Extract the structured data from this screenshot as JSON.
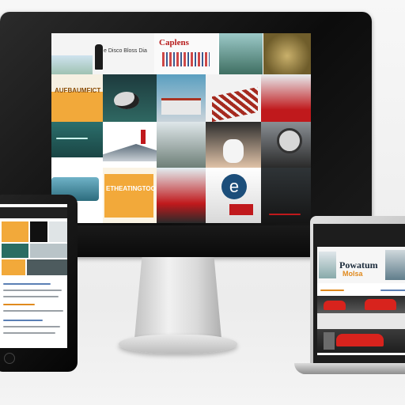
{
  "scene": {
    "background": "#f2f2f2",
    "devices": [
      "desktop-monitor",
      "tablet",
      "laptop"
    ]
  },
  "desktop": {
    "header_text": "e Disco Bloss Dia",
    "brand_text": "Caplens",
    "tiles": [
      {
        "caption": "AUFBAUMFICT",
        "color": "#f2a93a"
      },
      {
        "caption": "ETHEATINGTOO",
        "color": "#f2a93a"
      }
    ],
    "accent_colors": {
      "orange": "#f2a93a",
      "teal": "#1e5f63",
      "red": "#c0191c",
      "sky": "#6fb2c7"
    }
  },
  "tablet": {
    "colors": {
      "orange": "#f2a93a",
      "teal": "#2a6d63"
    }
  },
  "laptop": {
    "headline": "Powatum",
    "subhead": "Molsa",
    "colors": {
      "red": "#d8231d",
      "orange": "#e08a1e"
    }
  }
}
